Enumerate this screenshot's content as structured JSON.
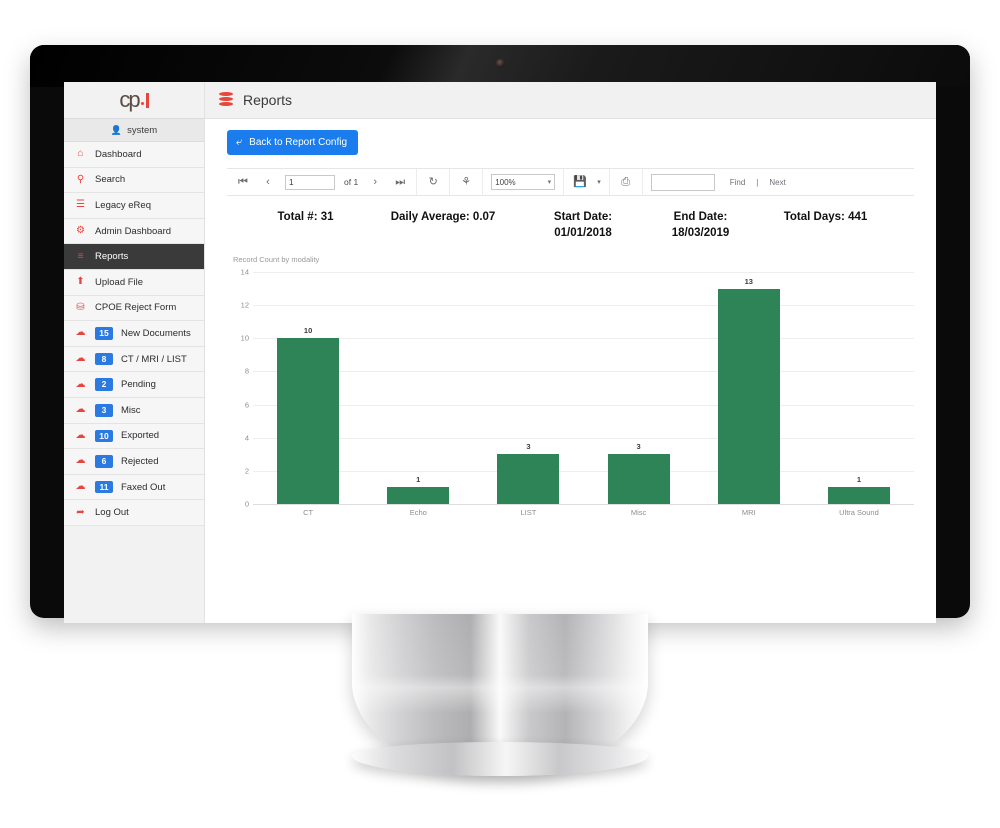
{
  "window": {
    "logo": {
      "text": "cp",
      "dot": "·",
      "bar": "|"
    }
  },
  "sidebar": {
    "user": {
      "label": "system",
      "icon": "user-icon"
    },
    "items": [
      {
        "label": "Dashboard",
        "icon": "home-icon",
        "badge": null,
        "active": false
      },
      {
        "label": "Search",
        "icon": "search-icon",
        "badge": null,
        "active": false
      },
      {
        "label": "Legacy eReq",
        "icon": "archive-icon",
        "badge": null,
        "active": false
      },
      {
        "label": "Admin Dashboard",
        "icon": "cogs-icon",
        "badge": null,
        "active": false
      },
      {
        "label": "Reports",
        "icon": "database-icon",
        "badge": null,
        "active": true
      },
      {
        "label": "Upload File",
        "icon": "upload-file-icon",
        "badge": null,
        "active": false
      },
      {
        "label": "CPOE Reject Form",
        "icon": "form-icon",
        "badge": null,
        "active": false
      },
      {
        "label": "New Documents",
        "icon": "inbox-icon",
        "badge": "15",
        "active": false
      },
      {
        "label": "CT / MRI / LIST",
        "icon": "inbox-icon",
        "badge": "8",
        "active": false
      },
      {
        "label": "Pending",
        "icon": "inbox-icon",
        "badge": "2",
        "active": false
      },
      {
        "label": "Misc",
        "icon": "inbox-icon",
        "badge": "3",
        "active": false
      },
      {
        "label": "Exported",
        "icon": "inbox-icon",
        "badge": "10",
        "active": false
      },
      {
        "label": "Rejected",
        "icon": "inbox-icon",
        "badge": "6",
        "active": false
      },
      {
        "label": "Faxed Out",
        "icon": "inbox-icon",
        "badge": "11",
        "active": false
      },
      {
        "label": "Log Out",
        "icon": "logout-icon",
        "badge": null,
        "active": false
      }
    ]
  },
  "header": {
    "title": "Reports",
    "icon": "database-icon"
  },
  "actions": {
    "back_label": "Back to Report Config",
    "back_icon": "arrow-back-icon"
  },
  "report_toolbar": {
    "first_page_icon": "first-page-icon",
    "prev_page_icon": "prev-page-icon",
    "page_value": "1",
    "page_of": "of 1",
    "next_page_icon": "next-page-icon",
    "last_page_icon": "last-page-icon",
    "refresh_icon": "refresh-icon",
    "back_parent_icon": "back-to-parent-icon",
    "zoom_value": "100%",
    "export_icon": "save-disk-icon",
    "print_icon": "print-icon",
    "find_placeholder": "",
    "find_value": "",
    "find_label": "Find",
    "find_sep": "|",
    "next_label": "Next"
  },
  "stats": [
    {
      "label": "Total #: 31"
    },
    {
      "label": "Daily Average: 0.07"
    },
    {
      "label": "Start Date:",
      "value": "01/01/2018"
    },
    {
      "label": "End Date:",
      "value": "18/03/2019"
    },
    {
      "label": "Total Days: 441"
    }
  ],
  "chart_data": {
    "type": "bar",
    "title": "Record Count by modality",
    "categories": [
      "CT",
      "Echo",
      "LIST",
      "Misc",
      "MRI",
      "Ultra Sound"
    ],
    "values": [
      10,
      1,
      3,
      3,
      13,
      1
    ],
    "data_labels": [
      "10",
      "1",
      "3",
      "3",
      "13",
      "1"
    ],
    "xlabel": "",
    "ylabel": "",
    "ylim": [
      0,
      14
    ],
    "yticks": [
      0,
      2,
      4,
      6,
      8,
      10,
      12,
      14
    ],
    "ytick_labels": [
      "0",
      "2",
      "4",
      "6",
      "8",
      "10",
      "12",
      "14"
    ],
    "grid": true,
    "legend": false,
    "series_color": "#2e8457"
  },
  "colors": {
    "accent_red": "#e8453c",
    "badge_blue": "#2a7ae2",
    "button_blue": "#1a7ced",
    "bar_green": "#2e8457",
    "active_nav": "#3a3a3a"
  }
}
